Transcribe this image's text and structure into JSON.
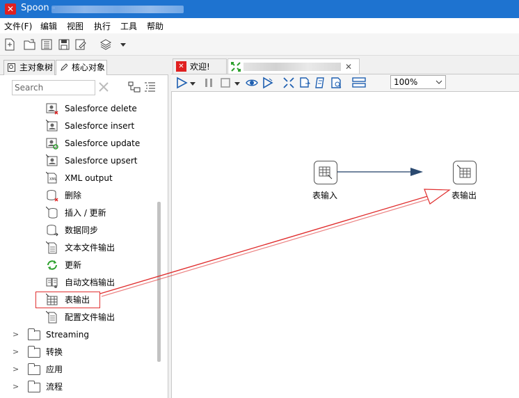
{
  "titlebar": {
    "app_name": "Spoon -"
  },
  "menu": [
    "文件(F)",
    "编辑",
    "视图",
    "执行",
    "工具",
    "帮助"
  ],
  "left_tabs": {
    "tab1": "主对象树",
    "tab2": "核心对象"
  },
  "search": {
    "placeholder": "Search"
  },
  "tree_items": [
    "Salesforce delete",
    "Salesforce insert",
    "Salesforce update",
    "Salesforce upsert",
    "XML output",
    "删除",
    "插入 / 更新",
    "数据同步",
    "文本文件输出",
    "更新",
    "自动文档输出",
    "表输出",
    "配置文件输出"
  ],
  "folders": [
    "Streaming",
    "转换",
    "应用",
    "流程"
  ],
  "right_tabs": {
    "welcome": "欢迎!"
  },
  "zoom": "100%",
  "steps": {
    "input": "表输入",
    "output": "表输出"
  },
  "colors": {
    "titlebar": "#1e73d0",
    "highlight": "#e03030"
  }
}
